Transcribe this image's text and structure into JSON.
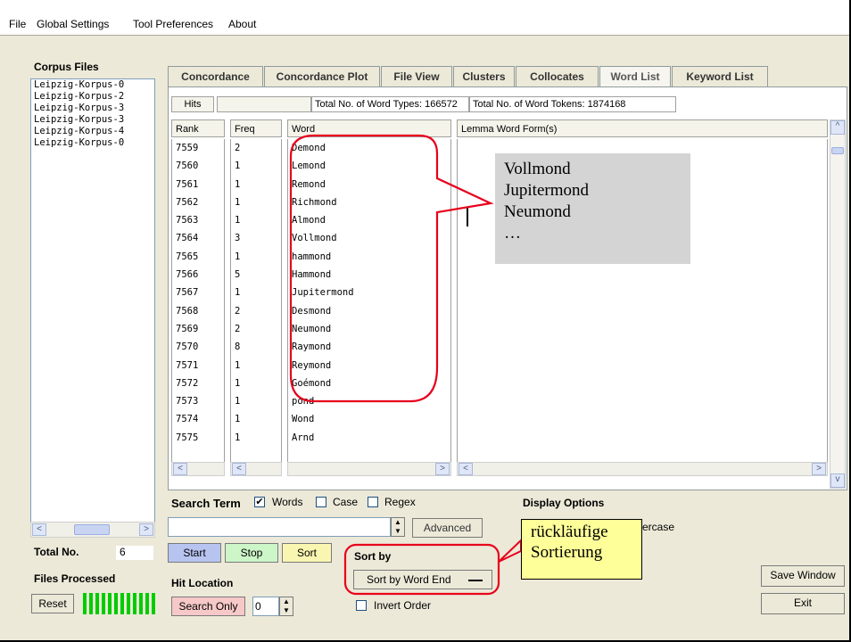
{
  "menu": [
    "File",
    "Global Settings",
    "Tool Preferences",
    "About"
  ],
  "corpus": {
    "title": "Corpus Files",
    "files": [
      "Leipzig-Korpus-0",
      "Leipzig-Korpus-2",
      "Leipzig-Korpus-3",
      "Leipzig-Korpus-3",
      "Leipzig-Korpus-4",
      "Leipzig-Korpus-0"
    ],
    "total_label": "Total No.",
    "total_value": "6",
    "processed_label": "Files Processed",
    "reset_label": "Reset"
  },
  "tabs": [
    "Concordance",
    "Concordance Plot",
    "File View",
    "Clusters",
    "Collocates",
    "Word List",
    "Keyword List"
  ],
  "stats": {
    "hits_label": "Hits",
    "types": "Total No. of Word Types: 166572",
    "tokens": "Total No. of Word Tokens: 1874168"
  },
  "columns": [
    "Rank",
    "Freq",
    "Word",
    "Lemma Word Form(s)"
  ],
  "rows": [
    {
      "rank": "7559",
      "freq": "2",
      "word": "Demond"
    },
    {
      "rank": "7560",
      "freq": "1",
      "word": "Lemond"
    },
    {
      "rank": "7561",
      "freq": "1",
      "word": "Remond"
    },
    {
      "rank": "7562",
      "freq": "1",
      "word": "Richmond"
    },
    {
      "rank": "7563",
      "freq": "1",
      "word": "Almond"
    },
    {
      "rank": "7564",
      "freq": "3",
      "word": "Vollmond"
    },
    {
      "rank": "7565",
      "freq": "1",
      "word": "hammond"
    },
    {
      "rank": "7566",
      "freq": "5",
      "word": "Hammond"
    },
    {
      "rank": "7567",
      "freq": "1",
      "word": "Jupitermond"
    },
    {
      "rank": "7568",
      "freq": "2",
      "word": "Desmond"
    },
    {
      "rank": "7569",
      "freq": "2",
      "word": "Neumond"
    },
    {
      "rank": "7570",
      "freq": "8",
      "word": "Raymond"
    },
    {
      "rank": "7571",
      "freq": "1",
      "word": "Reymond"
    },
    {
      "rank": "7572",
      "freq": "1",
      "word": "Goémond"
    },
    {
      "rank": "7573",
      "freq": "1",
      "word": "pond"
    },
    {
      "rank": "7574",
      "freq": "1",
      "word": "Wond"
    },
    {
      "rank": "7575",
      "freq": "1",
      "word": "Arnd"
    }
  ],
  "callout_words": [
    "Vollmond",
    "Jupitermond",
    "Neumond",
    "…"
  ],
  "callout_sort": [
    "rückläufige",
    "Sortierung"
  ],
  "search": {
    "label": "Search Term",
    "words_label": "Words",
    "case_label": "Case",
    "regex_label": "Regex",
    "value": "",
    "advanced_label": "Advanced",
    "start_label": "Start",
    "stop_label": "Stop",
    "sort_label": "Sort"
  },
  "hit_location": {
    "label": "Hit Location",
    "search_only_label": "Search Only",
    "value": "0"
  },
  "sort_by": {
    "label": "Sort by",
    "selected": "Sort by Word End",
    "invert_label": "Invert Order"
  },
  "display": {
    "label": "Display Options",
    "partial_label": "ercase"
  },
  "save_window_label": "Save Window",
  "exit_label": "Exit",
  "colors": {
    "red": "#e8001c",
    "callout_gray": "#d4d4d4",
    "note_yellow": "#ffff99",
    "progress_green": "#00cc00",
    "start_blue": "#b8c4f0",
    "stop_green": "#ccf5c8",
    "sort_yellow": "#f8f6b0",
    "search_only_pink": "#f6c8c8"
  }
}
